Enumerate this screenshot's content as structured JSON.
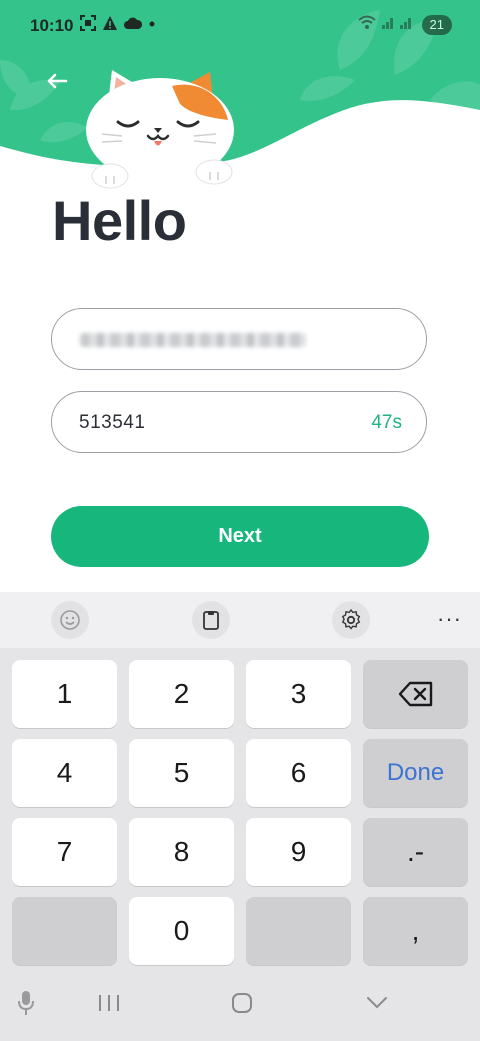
{
  "status_bar": {
    "time": "10:10",
    "battery": "21",
    "notification_icons": [
      "screenshot-icon",
      "warning-icon",
      "cloud-icon",
      "dot-icon"
    ]
  },
  "colors": {
    "brand": "#16b67d",
    "header": "#34c38b",
    "timer": "#1eb47e",
    "done": "#3d73d1"
  },
  "page": {
    "title": "Hello",
    "email_value_blurred": true,
    "code_value": "513541",
    "countdown": "47s",
    "next_label": "Next"
  },
  "keyboard": {
    "toolbar": [
      "emoji-icon",
      "clipboard-icon",
      "settings-icon",
      "more-icon"
    ],
    "more_label": "···",
    "rows": [
      [
        "1",
        "2",
        "3",
        "⌫"
      ],
      [
        "4",
        "5",
        "6",
        "Done"
      ],
      [
        "7",
        "8",
        "9",
        ".-"
      ],
      [
        "",
        "0",
        "",
        ","
      ]
    ],
    "done_label": "Done",
    "dot_dash_label": ".-",
    "comma_label": ","
  }
}
